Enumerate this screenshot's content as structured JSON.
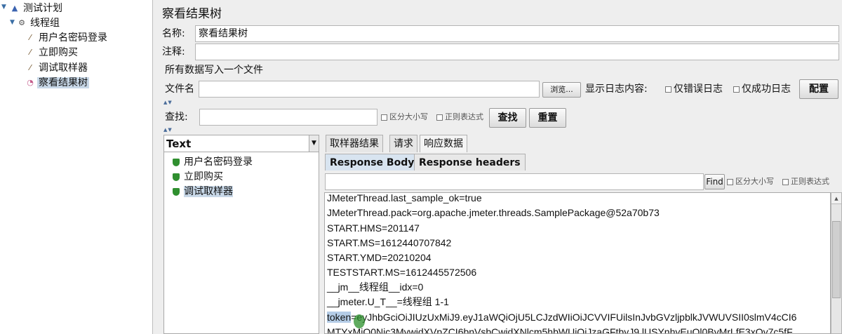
{
  "tree": {
    "items": [
      {
        "label": "测试计划"
      },
      {
        "label": "线程组"
      },
      {
        "label": "用户名密码登录"
      },
      {
        "label": "立即购买"
      },
      {
        "label": "调试取样器"
      },
      {
        "label": "察看结果树"
      }
    ]
  },
  "panel": {
    "title": "察看结果树",
    "name_label": "名称:",
    "name_value": "察看结果树",
    "comment_label": "注释:",
    "comment_value": "",
    "file_section_title": "所有数据写入一个文件",
    "filename_label": "文件名",
    "filename_value": "",
    "browse_button": "浏览...",
    "log_label": "显示日志内容:",
    "errors_only": "仅错误日志",
    "success_only": "仅成功日志",
    "configure_button": "配置"
  },
  "search": {
    "label": "查找:",
    "value": "",
    "case_sensitive": "区分大小写",
    "regex": "正则表达式",
    "find_button": "查找",
    "reset_button": "重置"
  },
  "sampler_list": {
    "renderer": "Text",
    "items": [
      {
        "label": "用户名密码登录"
      },
      {
        "label": "立即购买"
      },
      {
        "label": "调试取样器"
      }
    ]
  },
  "result_tabs": [
    "取样器结果",
    "请求",
    "响应数据"
  ],
  "response_tabs": [
    "Response Body",
    "Response headers"
  ],
  "findbar": {
    "find_button": "Find",
    "case_sensitive": "区分大小写",
    "regex": "正则表达式"
  },
  "response_lines": [
    "JMeterThread.last_sample_ok=true",
    "JMeterThread.pack=org.apache.jmeter.threads.SamplePackage@52a70b73",
    "START.HMS=201147",
    "START.MS=1612440707842",
    "START.YMD=20210204",
    "TESTSTART.MS=1612445572506",
    "__jm__线程组__idx=0",
    "__jmeter.U_T__=线程组 1-1"
  ],
  "token_line": {
    "key": "token",
    "rest": "=eyJhbGciOiJIUzUxMiJ9.eyJ1aWQiOjU5LCJzdWIiOiJCVVIFUilsInJvbGVzljpblkJVWUVSII0slmV4cCI6"
  },
  "last_line": "MTYxMiQ0Nic3MywidXVpZCI6bnVsbCwidXNlcm5hbWUiOiJzaGFtbyJ9.lUSYnhyEuQl0ByMrLfE3xQy7c5fF"
}
